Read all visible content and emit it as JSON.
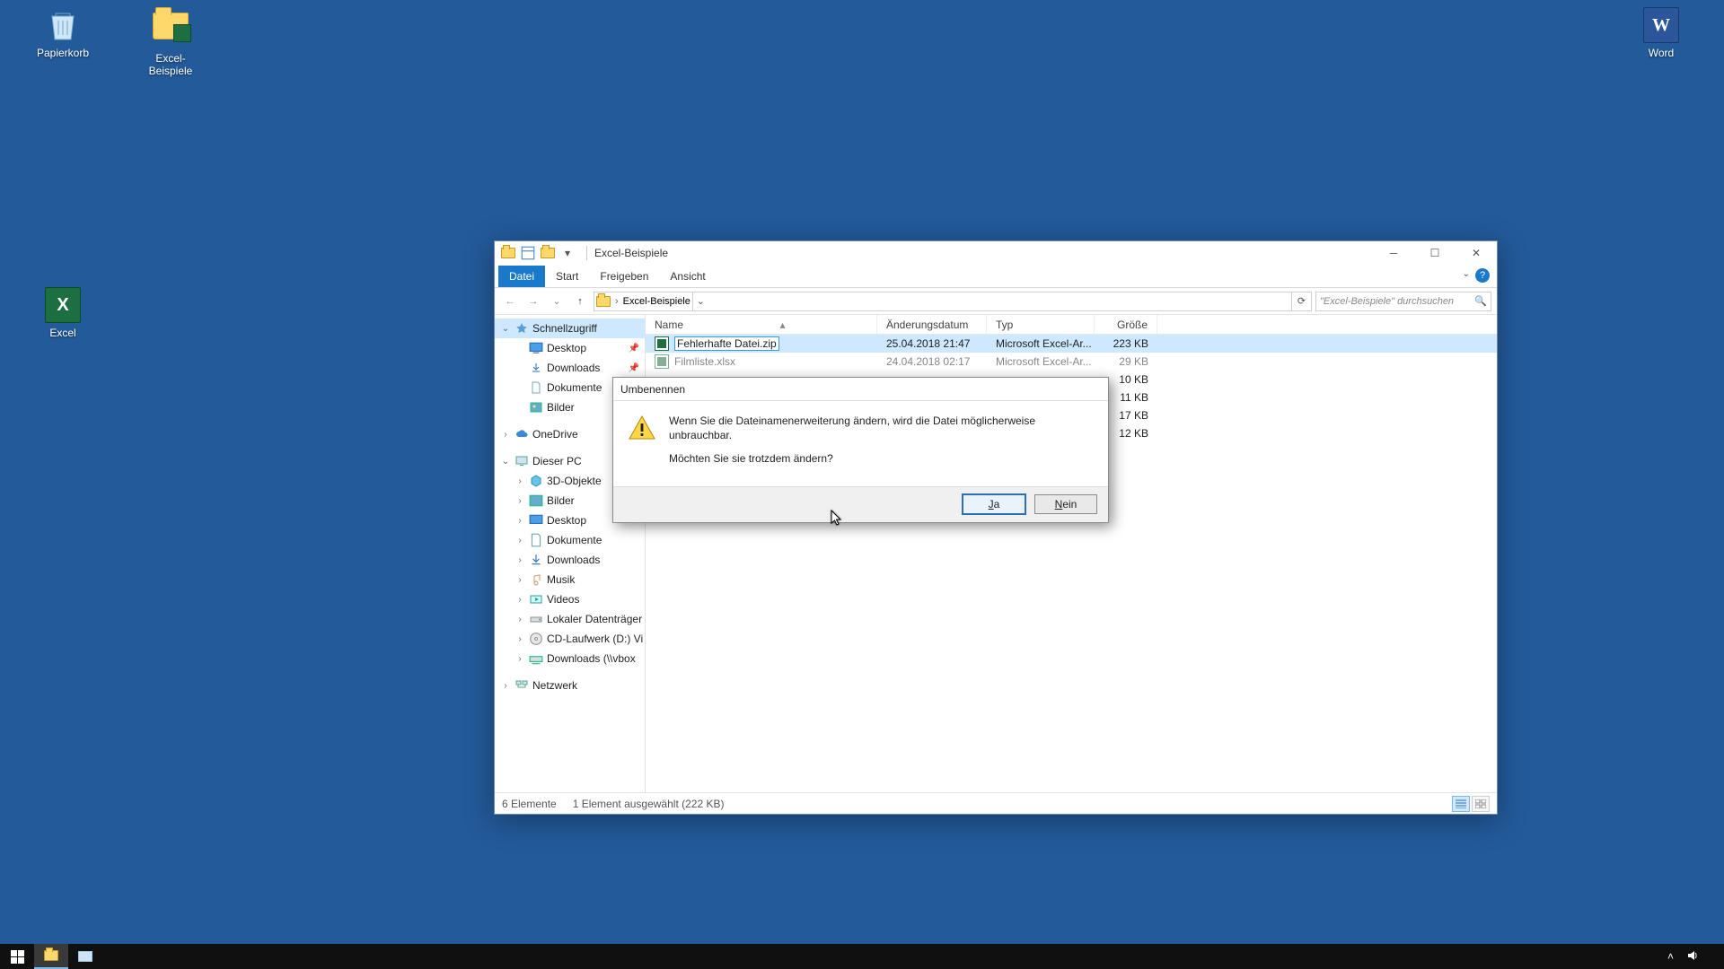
{
  "desktop": {
    "icons": [
      {
        "id": "recycle-bin",
        "label": "Papierkorb"
      },
      {
        "id": "excel-samples-folder",
        "label": "Excel-Beispiele"
      },
      {
        "id": "word",
        "label": "Word"
      },
      {
        "id": "excel",
        "label": "Excel"
      }
    ]
  },
  "explorer": {
    "title": "Excel-Beispiele",
    "ribbon": {
      "file": "Datei",
      "tabs": [
        "Start",
        "Freigeben",
        "Ansicht"
      ]
    },
    "breadcrumb": {
      "location": "Excel-Beispiele"
    },
    "search_placeholder": "\"Excel-Beispiele\" durchsuchen",
    "nav": {
      "quick": {
        "label": "Schnellzugriff",
        "pinned": [
          {
            "label": "Desktop"
          },
          {
            "label": "Downloads"
          },
          {
            "label": "Dokumente"
          },
          {
            "label": "Bilder"
          }
        ]
      },
      "onedrive": {
        "label": "OneDrive"
      },
      "thispc": {
        "label": "Dieser PC",
        "children": [
          {
            "label": "3D-Objekte"
          },
          {
            "label": "Bilder"
          },
          {
            "label": "Desktop"
          },
          {
            "label": "Dokumente"
          },
          {
            "label": "Downloads"
          },
          {
            "label": "Musik"
          },
          {
            "label": "Videos"
          },
          {
            "label": "Lokaler Datenträger"
          },
          {
            "label": "CD-Laufwerk (D:) Vi"
          },
          {
            "label": "Downloads (\\\\vbox"
          }
        ]
      },
      "network": {
        "label": "Netzwerk"
      }
    },
    "columns": {
      "name": "Name",
      "date": "Änderungsdatum",
      "type": "Typ",
      "size": "Größe"
    },
    "rows": [
      {
        "name_edit": "Fehlerhafte Datei.zip",
        "date": "25.04.2018 21:47",
        "type": "Microsoft Excel-Ar...",
        "size": "223 KB",
        "selected": true,
        "renaming": true
      },
      {
        "name": "Filmliste.xlsx",
        "date": "24.04.2018 02:17",
        "type": "Microsoft Excel-Ar...",
        "size": "29 KB"
      },
      {
        "name": "",
        "date": "",
        "type": "",
        "size": "10 KB"
      },
      {
        "name": "",
        "date": "",
        "type": "",
        "size": "11 KB"
      },
      {
        "name": "",
        "date": "",
        "type": "",
        "size": "17 KB"
      },
      {
        "name": "",
        "date": "",
        "type": "",
        "size": "12 KB"
      }
    ],
    "status": {
      "count": "6 Elemente",
      "selection": "1 Element ausgewählt (222 KB)"
    }
  },
  "dialog": {
    "title": "Umbenennen",
    "line1": "Wenn Sie die Dateinamenerweiterung ändern, wird die Datei möglicherweise unbrauchbar.",
    "line2": "Möchten Sie sie trotzdem ändern?",
    "yes": "Ja",
    "no": "Nein"
  },
  "tray": {
    "time": ""
  }
}
